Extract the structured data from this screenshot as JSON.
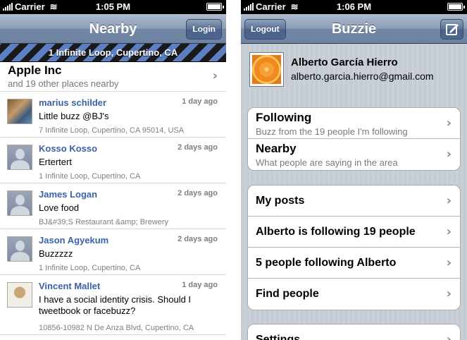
{
  "left": {
    "status": {
      "carrier": "Carrier",
      "time": "1:05 PM"
    },
    "nav": {
      "title": "Nearby",
      "button": "Login"
    },
    "location": "1 Infinite Loop, Cupertino, CA",
    "place": {
      "name": "Apple Inc",
      "sub": "and 19 other places nearby"
    },
    "posts": [
      {
        "author": "marius schilder",
        "time": "1 day ago",
        "text": "Little buzz @BJ's",
        "loc": "7 Infinite Loop, Cupertino, CA 95014, USA",
        "avatar": "photo-avatar"
      },
      {
        "author": "Kosso Kosso",
        "time": "2 days ago",
        "text": "Ertertert",
        "loc": "1 Infinite Loop, Cupertino, CA",
        "avatar": "default-avatar"
      },
      {
        "author": "James Logan",
        "time": "2 days ago",
        "text": "Love food",
        "loc": "BJ&#39;S Restaurant &amp; Brewery",
        "avatar": "default-avatar"
      },
      {
        "author": "Jason Agyekum",
        "time": "2 days ago",
        "text": "Buzzzzz",
        "loc": "1 Infinite Loop, Cupertino, CA",
        "avatar": "default-avatar"
      },
      {
        "author": "Vincent Mallet",
        "time": "1 day ago",
        "text": "I have a social identity crisis. Should I tweetbook or facebuzz?",
        "loc": "10856-10982 N De Anza Blvd, Cupertino, CA",
        "avatar": "photo-avatar"
      }
    ]
  },
  "right": {
    "status": {
      "carrier": "Carrier",
      "time": "1:06 PM"
    },
    "nav": {
      "title": "Buzzie",
      "button": "Logout",
      "compose_icon": "compose-icon"
    },
    "profile": {
      "name": "Alberto García Hierro",
      "email": "alberto.garcia.hierro@gmail.com"
    },
    "group1": [
      {
        "title": "Following",
        "sub": "Buzz from the 19 people I'm following"
      },
      {
        "title": "Nearby",
        "sub": "What people are saying in the area"
      }
    ],
    "group2": [
      {
        "title": "My posts"
      },
      {
        "title": "Alberto is following 19 people"
      },
      {
        "title": "5 people following Alberto"
      },
      {
        "title": "Find people"
      }
    ],
    "group3": [
      {
        "title": "Settings"
      }
    ]
  }
}
